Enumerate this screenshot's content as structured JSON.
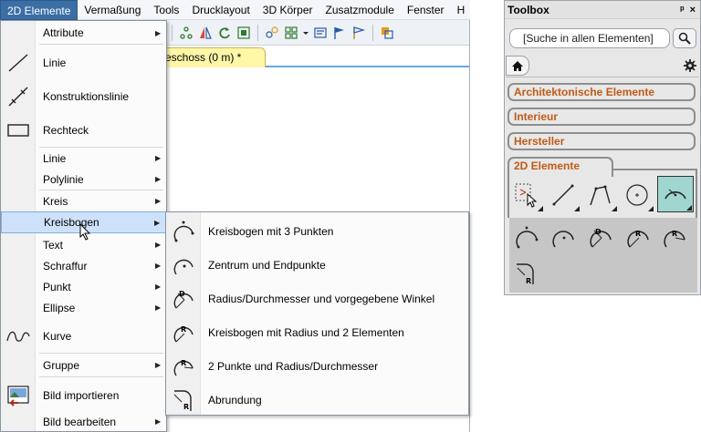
{
  "menubar": {
    "items": [
      {
        "label": "2D Elemente"
      },
      {
        "label": "Vermaßung"
      },
      {
        "label": "Tools"
      },
      {
        "label": "Drucklayout"
      },
      {
        "label": "3D Körper"
      },
      {
        "label": "Zusatzmodule"
      },
      {
        "label": "Fenster"
      },
      {
        "label": "H"
      }
    ]
  },
  "tab": {
    "label": "eschoss (0 m) *"
  },
  "menu": {
    "items": [
      {
        "label": "Attribute",
        "icon": "none",
        "submenu": true
      },
      {
        "label": "Linie",
        "icon": "line-icon",
        "submenu": false
      },
      {
        "label": "Konstruktionslinie",
        "icon": "construction-line-icon",
        "submenu": false
      },
      {
        "label": "Rechteck",
        "icon": "rectangle-icon",
        "submenu": false
      },
      {
        "label": "Linie",
        "icon": "none",
        "submenu": true
      },
      {
        "label": "Polylinie",
        "icon": "none",
        "submenu": true
      },
      {
        "label": "Kreis",
        "icon": "none",
        "submenu": true
      },
      {
        "label": "Kreisbogen",
        "icon": "none",
        "submenu": true
      },
      {
        "label": "Text",
        "icon": "none",
        "submenu": true
      },
      {
        "label": "Schraffur",
        "icon": "none",
        "submenu": true
      },
      {
        "label": "Punkt",
        "icon": "none",
        "submenu": true
      },
      {
        "label": "Ellipse",
        "icon": "none",
        "submenu": true
      },
      {
        "label": "Kurve",
        "icon": "curve-icon",
        "submenu": false
      },
      {
        "label": "Gruppe",
        "icon": "none",
        "submenu": true
      },
      {
        "label": "Bild importieren",
        "icon": "import-image-icon",
        "submenu": false
      },
      {
        "label": "Bild bearbeiten",
        "icon": "none",
        "submenu": true
      }
    ],
    "highlighted": "Kreisbogen"
  },
  "submenu": {
    "items": [
      {
        "label": "Kreisbogen mit 3 Punkten",
        "icon": "arc-3-points-icon"
      },
      {
        "label": "Zentrum und Endpunkte",
        "icon": "arc-center-endpoints-icon"
      },
      {
        "label": "Radius/Durchmesser und vorgegebene Winkel",
        "icon": "arc-radius-angle-icon"
      },
      {
        "label": "Kreisbogen mit Radius und 2 Elementen",
        "icon": "arc-radius-2-elements-icon"
      },
      {
        "label": "2 Punkte und Radius/Durchmesser",
        "icon": "arc-2-points-radius-icon"
      },
      {
        "label": "Abrundung",
        "icon": "fillet-icon"
      }
    ]
  },
  "toolbox": {
    "title": "Toolbox",
    "pin_glyph": "ᵖ",
    "close_glyph": "×",
    "search_placeholder": "[Suche in allen Elementen]",
    "categories": [
      {
        "label": "Architektonische Elemente"
      },
      {
        "label": "Interieur"
      },
      {
        "label": "Hersteller"
      },
      {
        "label": "2D Elemente"
      }
    ],
    "tools_row1": [
      "select-tool-icon",
      "line-tool-icon",
      "polyline-tool-icon",
      "circle-tool-icon",
      "arc-tool-icon"
    ],
    "tools_row2": [
      "arc-3-points-icon",
      "arc-center-endpoints-icon",
      "arc-radius-angle-icon",
      "arc-radius-2-elements-icon",
      "arc-2-points-radius-icon"
    ],
    "tools_row3": [
      "fillet-icon"
    ]
  },
  "colors": {
    "accent": "#3a6ea5",
    "highlight": "#cde2fa",
    "category_text": "#c25a16",
    "selected_tool": "#9fd6cf",
    "tab_yellow": "#fff6a8"
  }
}
